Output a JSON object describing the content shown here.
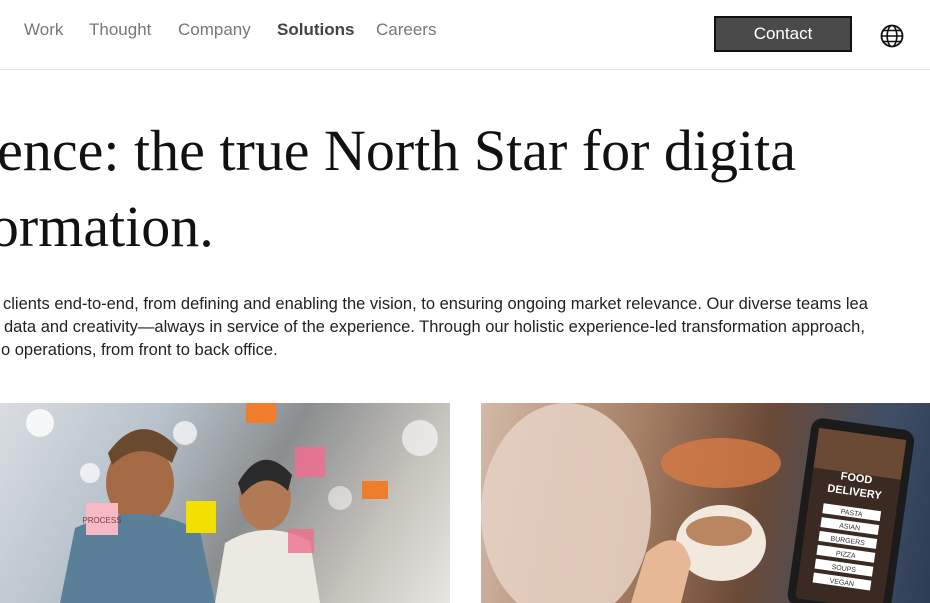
{
  "nav": {
    "links": [
      "Work",
      "Thought",
      "Company",
      "Solutions",
      "Careers"
    ],
    "active": "Solutions",
    "contact_label": "Contact",
    "globe_icon": "globe-icon"
  },
  "hero": {
    "headline_line1": "erience: the true North Star for digita",
    "headline_line2": "sformation."
  },
  "body": {
    "line1": "clients end-to-end, from defining and enabling the vision, to ensuring ongoing market relevance. Our diverse teams lea",
    "line2": "data and creativity—always in service of the experience. Through our holistic experience-led transformation approach,",
    "line3": "o operations, from front to back office."
  },
  "images": {
    "left_image": {
      "description": "team-collaboration-photo",
      "sticky_note_text": "PROCESS"
    },
    "right_image": {
      "description": "food-delivery-app-photo",
      "app_title_1": "FOOD",
      "app_title_2": "DELIVERY",
      "menu": [
        "PASTA",
        "ASIAN",
        "BURGERS",
        "PIZZA",
        "SOUPS",
        "VEGAN"
      ]
    }
  }
}
